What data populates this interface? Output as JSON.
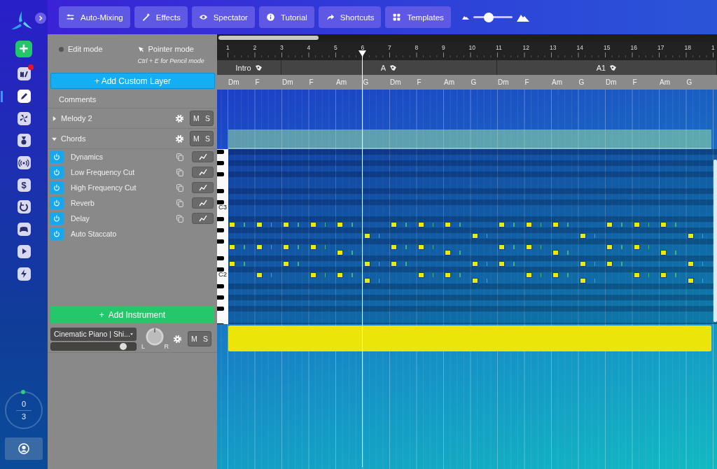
{
  "rail": {
    "items": [
      {
        "selected": false,
        "badge": true
      },
      {
        "selected": true,
        "badge": false
      },
      {
        "selected": false,
        "badge": false
      },
      {
        "selected": false,
        "badge": false
      },
      {
        "selected": false,
        "badge": false
      },
      {
        "selected": false,
        "badge": false,
        "glyph": "$"
      },
      {
        "selected": false,
        "badge": false
      },
      {
        "selected": false,
        "badge": false
      },
      {
        "selected": false,
        "badge": false
      },
      {
        "selected": false,
        "badge": false
      }
    ],
    "add": "+",
    "counter": {
      "value": "0",
      "total": "3"
    }
  },
  "toolbar": {
    "buttons": [
      "Auto-Mixing",
      "Effects",
      "Spectator",
      "Tutorial",
      "Shortcuts",
      "Templates"
    ],
    "zoom": {
      "level": 0.4
    }
  },
  "panel": {
    "modes": [
      {
        "label": "Edit mode",
        "selected": false
      },
      {
        "label": "Pointer mode",
        "selected": true,
        "hint": "Ctrl + E for Pencil mode"
      }
    ],
    "add_layer": "+ Add Custom Layer",
    "comments": "Comments",
    "layers": [
      {
        "name": "Melody 2",
        "expanded": false,
        "mute": "M",
        "solo": "S"
      },
      {
        "name": "Chords",
        "expanded": true,
        "mute": "M",
        "solo": "S",
        "effects": [
          {
            "name": "Dynamics",
            "on": true,
            "kind": "automatable"
          },
          {
            "name": "Low Frequency Cut",
            "on": true,
            "kind": "automatable"
          },
          {
            "name": "High Frequency Cut",
            "on": true,
            "kind": "automatable"
          },
          {
            "name": "Reverb",
            "on": true,
            "kind": "automatable"
          },
          {
            "name": "Delay",
            "on": true,
            "kind": "automatable"
          },
          {
            "name": "Auto Staccato",
            "on": true,
            "kind": "toggle"
          }
        ]
      }
    ],
    "add_instrument": "+  Add Instrument",
    "instrument": {
      "name": "Cinematic Piano | Shi...",
      "volume": {
        "level": 0.85
      },
      "pan_left": "L",
      "pan_right": "R",
      "mute": "M",
      "solo": "S"
    }
  },
  "timeline": {
    "bars": [
      "1",
      "2",
      "3",
      "4",
      "5",
      "6",
      "7",
      "8",
      "9",
      "10",
      "11",
      "12",
      "13",
      "14",
      "15",
      "16",
      "17",
      "18",
      "1"
    ],
    "sections": [
      {
        "label": "Intro",
        "chords": [
          {
            "label": "Dm",
            "kind": "dminor",
            "playhead": false
          },
          {
            "label": "F",
            "kind": "fmajor",
            "playhead": false
          }
        ]
      },
      {
        "label": "A",
        "chords": [
          {
            "label": "Dm",
            "kind": "dminor",
            "playhead": false
          },
          {
            "label": "F",
            "kind": "fmajor",
            "playhead": false
          },
          {
            "label": "Am",
            "kind": "aminor",
            "playhead": false
          },
          {
            "label": "G",
            "kind": "gmajor",
            "playhead": true
          },
          {
            "label": "Dm",
            "kind": "dminor",
            "playhead": false
          },
          {
            "label": "F",
            "kind": "fmajor",
            "playhead": false
          },
          {
            "label": "Am",
            "kind": "aminor",
            "playhead": false
          },
          {
            "label": "G",
            "kind": "gmajor",
            "playhead": false
          }
        ]
      },
      {
        "label": "A1",
        "chords": [
          {
            "label": "Dm",
            "kind": "dminor",
            "playhead": false
          },
          {
            "label": "F",
            "kind": "fmajor",
            "playhead": false
          },
          {
            "label": "Am",
            "kind": "aminor",
            "playhead": false
          },
          {
            "label": "G",
            "kind": "gmajor",
            "playhead": false
          },
          {
            "label": "Dm",
            "kind": "dminor",
            "playhead": false
          },
          {
            "label": "F",
            "kind": "fmajor",
            "playhead": false
          },
          {
            "label": "Am",
            "kind": "aminor",
            "playhead": false
          },
          {
            "label": "G",
            "kind": "gmajor",
            "playhead": false
          }
        ]
      }
    ],
    "key_labels": [
      {
        "text": "C3",
        "kind": "c3"
      },
      {
        "text": "C2",
        "kind": "c2"
      }
    ]
  }
}
